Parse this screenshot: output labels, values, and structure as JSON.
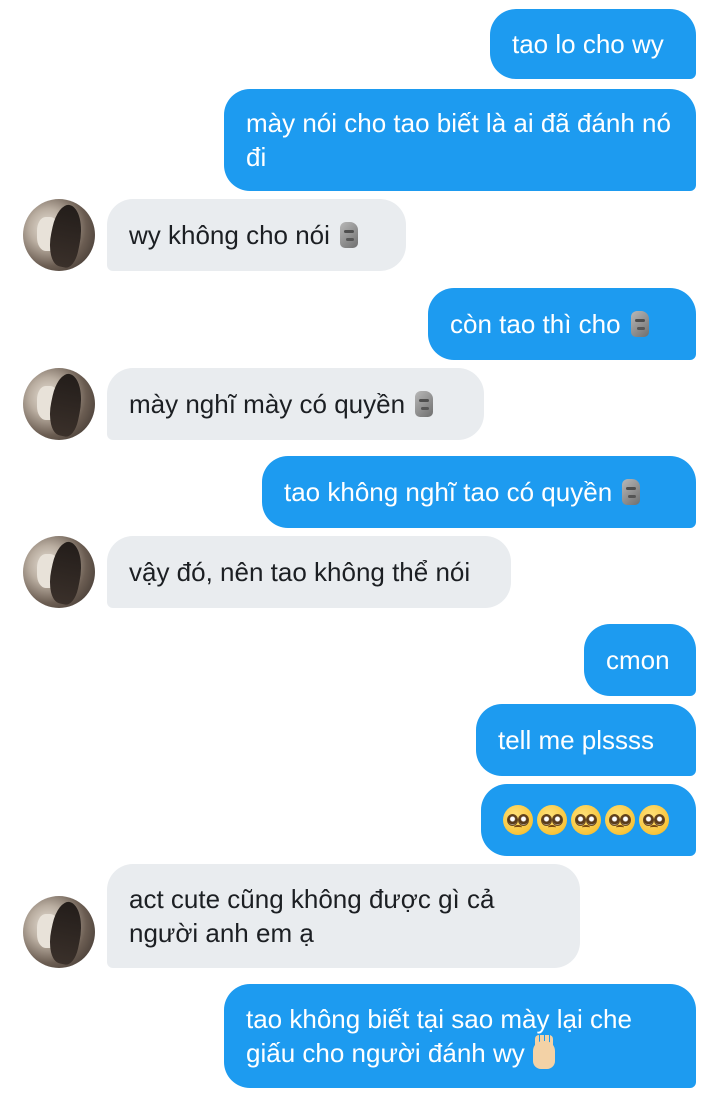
{
  "messages": [
    {
      "from": "me",
      "text": "tao lo cho wy"
    },
    {
      "from": "me",
      "text": "mày nói cho tao biết là ai đã đánh nó đi"
    },
    {
      "from": "them",
      "text": "wy không cho nói",
      "emoji": "moai"
    },
    {
      "from": "me",
      "text": "còn tao thì cho",
      "emoji": "moai"
    },
    {
      "from": "them",
      "text": "mày nghĩ mày có quyền",
      "emoji": "moai"
    },
    {
      "from": "me",
      "text": "tao không nghĩ tao có quyền",
      "emoji": "moai"
    },
    {
      "from": "them",
      "text": "vậy đó, nên tao không thể nói"
    },
    {
      "from": "me",
      "text": "cmon"
    },
    {
      "from": "me",
      "text": "tell me plssss"
    },
    {
      "from": "me",
      "emoji": "pleading-face x5"
    },
    {
      "from": "them",
      "text": "act cute cũng không được gì cả người anh em ạ"
    },
    {
      "from": "me",
      "text": "tao không biết tại sao mày lại che giấu cho người đánh wy",
      "emoji": "raised-hand"
    }
  ],
  "colors": {
    "outgoing_bubble": "#1d9bf0",
    "incoming_bubble": "#e9ecef",
    "outgoing_text": "#ffffff",
    "incoming_text": "#1c1f23"
  }
}
